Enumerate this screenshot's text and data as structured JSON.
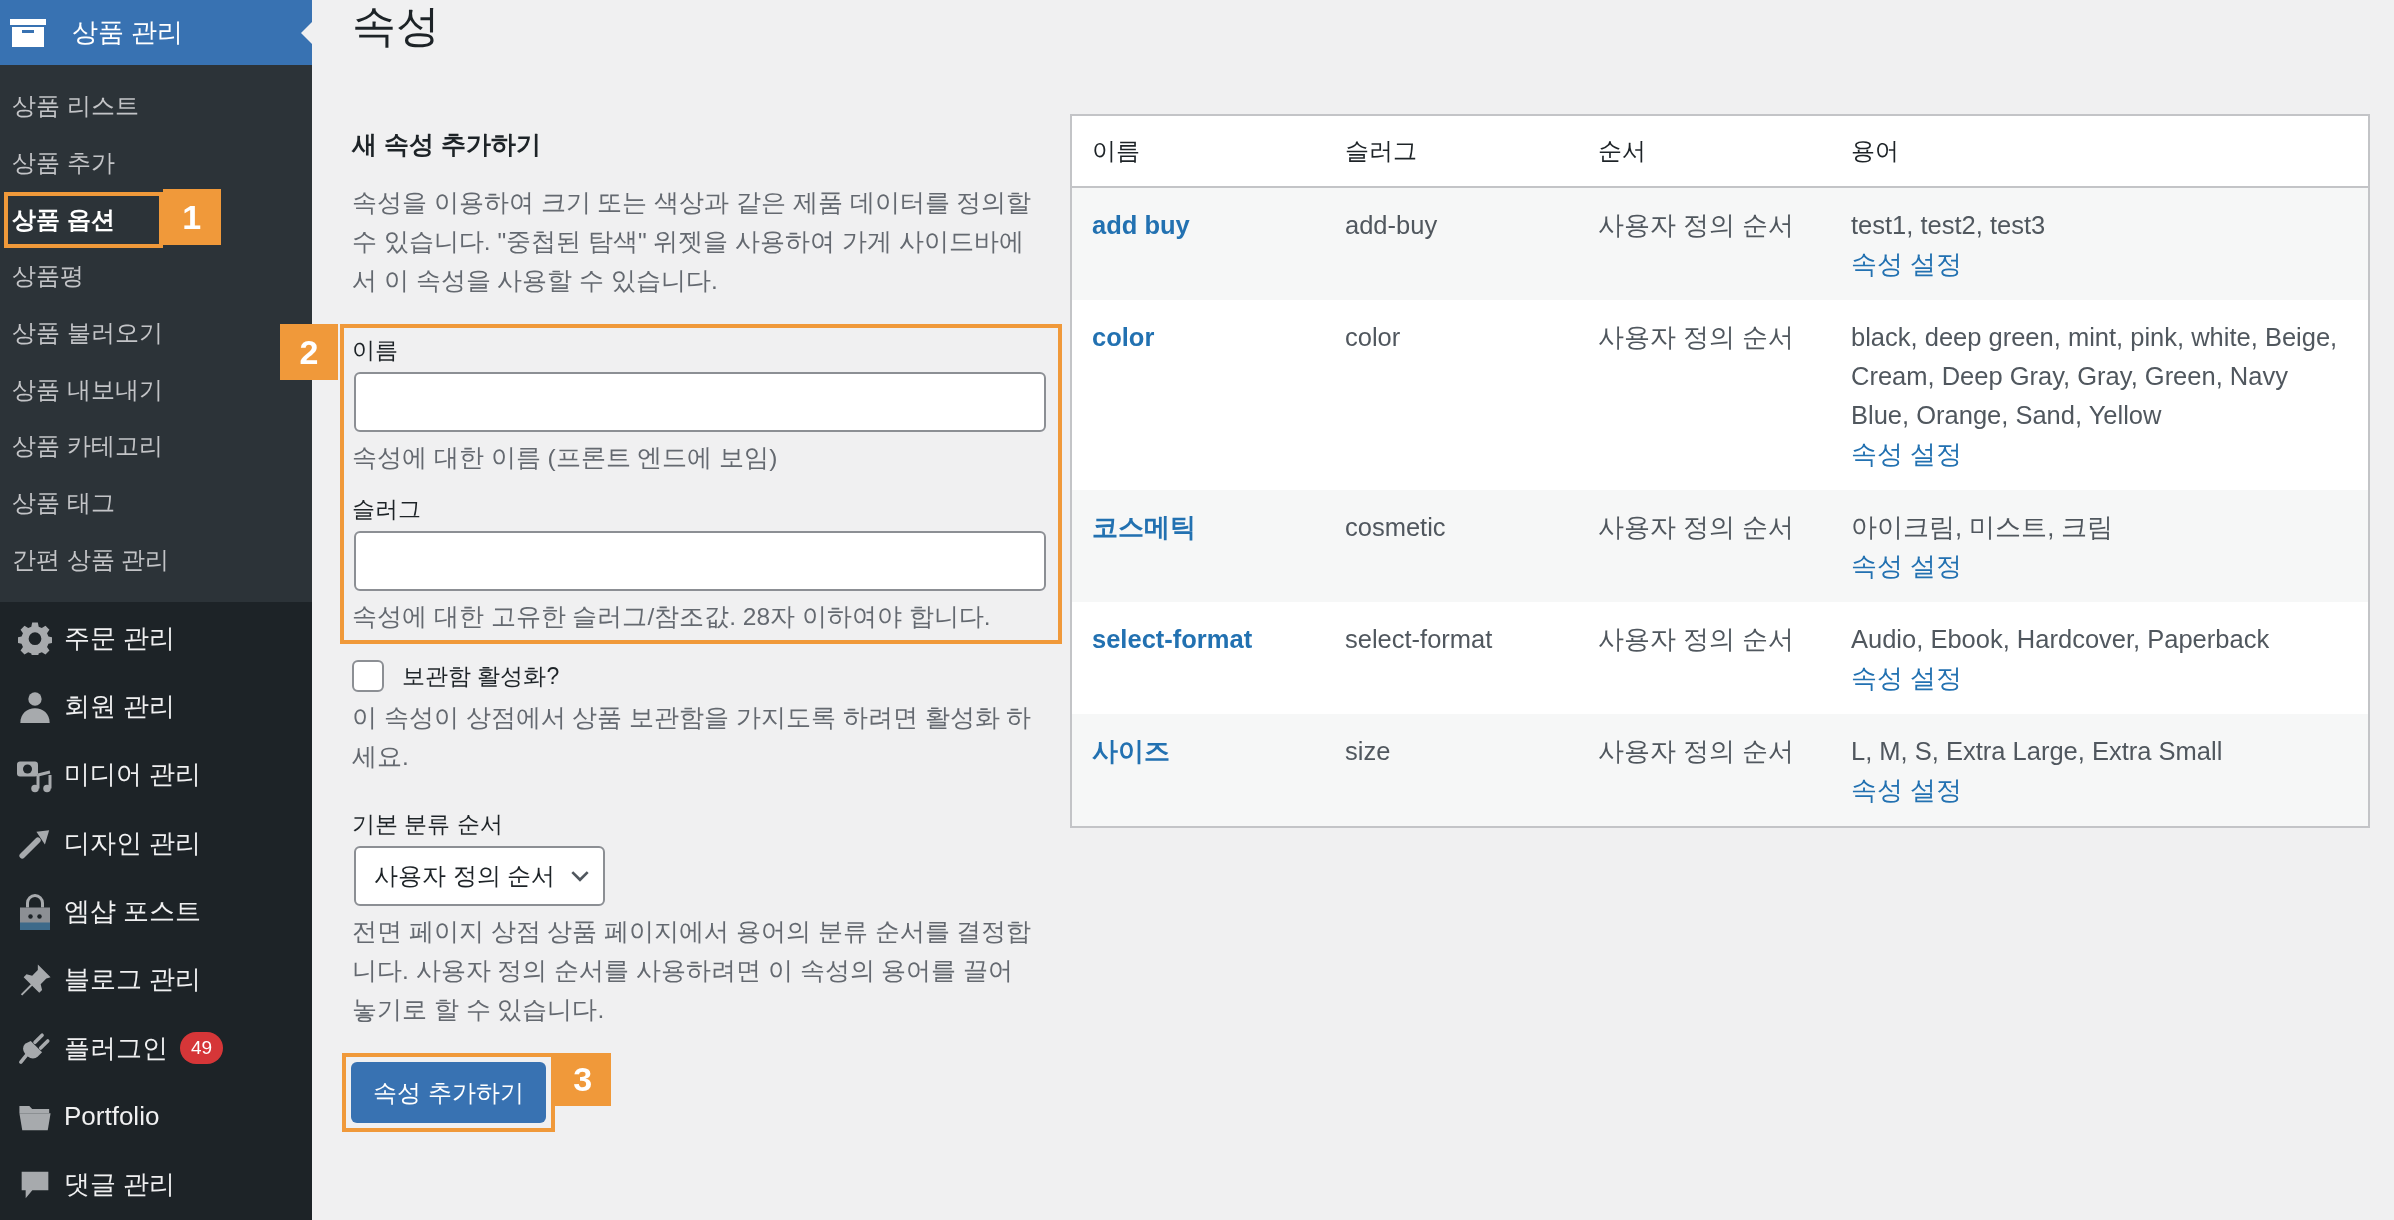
{
  "sidebar": {
    "header": {
      "label": "상품 관리"
    },
    "submenu": [
      {
        "label": "상품 리스트",
        "selected": false
      },
      {
        "label": "상품 추가",
        "selected": false
      },
      {
        "label": "상품 옵션",
        "selected": true,
        "callout": "1"
      },
      {
        "label": "상품평",
        "selected": false
      },
      {
        "label": "상품 불러오기",
        "selected": false
      },
      {
        "label": "상품 내보내기",
        "selected": false
      },
      {
        "label": "상품 카테고리",
        "selected": false
      },
      {
        "label": "상품 태그",
        "selected": false
      },
      {
        "label": "간편 상품 관리",
        "selected": false
      }
    ],
    "menu": [
      {
        "label": "주문 관리",
        "kind": "gear"
      },
      {
        "label": "회원 관리",
        "kind": "person"
      },
      {
        "label": "미디어 관리",
        "kind": "media"
      },
      {
        "label": "디자인 관리",
        "kind": "brush"
      },
      {
        "label": "엠샵 포스트",
        "kind": "bag"
      },
      {
        "label": "블로그 관리",
        "kind": "pin"
      },
      {
        "label": "플러그인",
        "kind": "plug",
        "badge": "49"
      },
      {
        "label": "Portfolio",
        "kind": "folder"
      },
      {
        "label": "댓글 관리",
        "kind": "bubble"
      }
    ]
  },
  "page": {
    "title": "속성"
  },
  "form": {
    "heading": "새 속성 추가하기",
    "intro": "속성을 이용하여 크기 또는 색상과 같은 제품 데이터를 정의할 수 있습니다. \"중첩된 탐색\" 위젯을 사용하여 가게 사이드바에서 이 속성을 사용할 수 있습니다.",
    "fields_callout": "2",
    "fields": [
      {
        "label": "이름",
        "hint": "속성에 대한 이름 (프론트 엔드에 보임)"
      },
      {
        "label": "슬러그",
        "hint": "속성에 대한 고유한 슬러그/참조값. 28자 이하여야 합니다."
      }
    ],
    "archive": {
      "label": "보관함 활성화?",
      "checked": false,
      "hint": "이 속성이 상점에서 상품 보관함을 가지도록 하려면 활성화 하세요."
    },
    "order": {
      "label": "기본 분류 순서",
      "value": "사용자 정의 순서",
      "hint": "전면 페이지 상점 상품 페이지에서 용어의 분류 순서를 결정합니다. 사용자 정의 순서를 사용하려면 이 속성의 용어를 끌어놓기로 할 수 있습니다."
    },
    "submit": {
      "label": "속성 추가하기",
      "callout": "3"
    }
  },
  "table": {
    "columns": [
      "이름",
      "슬러그",
      "순서",
      "용어"
    ],
    "rows": [
      {
        "name": "add buy",
        "slug": "add-buy",
        "order": "사용자 정의 순서",
        "terms": "test1, test2, test3",
        "link": "속성 설정"
      },
      {
        "name": "color",
        "slug": "color",
        "order": "사용자 정의 순서",
        "terms": "black, deep green, mint, pink, white, Beige, Cream, Deep Gray, Gray, Green, Navy Blue, Orange, Sand, Yellow",
        "link": "속성 설정"
      },
      {
        "name": "코스메틱",
        "slug": "cosmetic",
        "order": "사용자 정의 순서",
        "terms": "아이크림, 미스트, 크림",
        "link": "속성 설정"
      },
      {
        "name": "select-format",
        "slug": "select-format",
        "order": "사용자 정의 순서",
        "terms": "Audio, Ebook, Hardcover, Paperback",
        "link": "속성 설정"
      },
      {
        "name": "사이즈",
        "slug": "size",
        "order": "사용자 정의 순서",
        "terms": "L, M, S, Extra Large, Extra Small",
        "link": "속성 설정"
      }
    ]
  }
}
